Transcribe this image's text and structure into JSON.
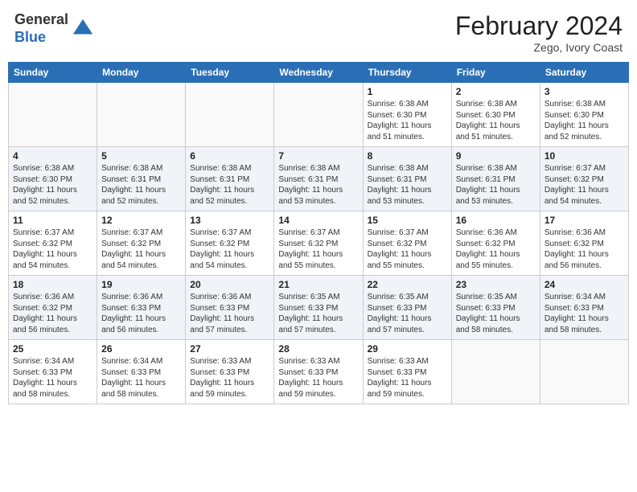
{
  "logo": {
    "general": "General",
    "blue": "Blue"
  },
  "header": {
    "month": "February 2024",
    "location": "Zego, Ivory Coast"
  },
  "weekdays": [
    "Sunday",
    "Monday",
    "Tuesday",
    "Wednesday",
    "Thursday",
    "Friday",
    "Saturday"
  ],
  "weeks": [
    [
      {
        "day": "",
        "info": ""
      },
      {
        "day": "",
        "info": ""
      },
      {
        "day": "",
        "info": ""
      },
      {
        "day": "",
        "info": ""
      },
      {
        "day": "1",
        "info": "Sunrise: 6:38 AM\nSunset: 6:30 PM\nDaylight: 11 hours\nand 51 minutes."
      },
      {
        "day": "2",
        "info": "Sunrise: 6:38 AM\nSunset: 6:30 PM\nDaylight: 11 hours\nand 51 minutes."
      },
      {
        "day": "3",
        "info": "Sunrise: 6:38 AM\nSunset: 6:30 PM\nDaylight: 11 hours\nand 52 minutes."
      }
    ],
    [
      {
        "day": "4",
        "info": "Sunrise: 6:38 AM\nSunset: 6:30 PM\nDaylight: 11 hours\nand 52 minutes."
      },
      {
        "day": "5",
        "info": "Sunrise: 6:38 AM\nSunset: 6:31 PM\nDaylight: 11 hours\nand 52 minutes."
      },
      {
        "day": "6",
        "info": "Sunrise: 6:38 AM\nSunset: 6:31 PM\nDaylight: 11 hours\nand 52 minutes."
      },
      {
        "day": "7",
        "info": "Sunrise: 6:38 AM\nSunset: 6:31 PM\nDaylight: 11 hours\nand 53 minutes."
      },
      {
        "day": "8",
        "info": "Sunrise: 6:38 AM\nSunset: 6:31 PM\nDaylight: 11 hours\nand 53 minutes."
      },
      {
        "day": "9",
        "info": "Sunrise: 6:38 AM\nSunset: 6:31 PM\nDaylight: 11 hours\nand 53 minutes."
      },
      {
        "day": "10",
        "info": "Sunrise: 6:37 AM\nSunset: 6:32 PM\nDaylight: 11 hours\nand 54 minutes."
      }
    ],
    [
      {
        "day": "11",
        "info": "Sunrise: 6:37 AM\nSunset: 6:32 PM\nDaylight: 11 hours\nand 54 minutes."
      },
      {
        "day": "12",
        "info": "Sunrise: 6:37 AM\nSunset: 6:32 PM\nDaylight: 11 hours\nand 54 minutes."
      },
      {
        "day": "13",
        "info": "Sunrise: 6:37 AM\nSunset: 6:32 PM\nDaylight: 11 hours\nand 54 minutes."
      },
      {
        "day": "14",
        "info": "Sunrise: 6:37 AM\nSunset: 6:32 PM\nDaylight: 11 hours\nand 55 minutes."
      },
      {
        "day": "15",
        "info": "Sunrise: 6:37 AM\nSunset: 6:32 PM\nDaylight: 11 hours\nand 55 minutes."
      },
      {
        "day": "16",
        "info": "Sunrise: 6:36 AM\nSunset: 6:32 PM\nDaylight: 11 hours\nand 55 minutes."
      },
      {
        "day": "17",
        "info": "Sunrise: 6:36 AM\nSunset: 6:32 PM\nDaylight: 11 hours\nand 56 minutes."
      }
    ],
    [
      {
        "day": "18",
        "info": "Sunrise: 6:36 AM\nSunset: 6:32 PM\nDaylight: 11 hours\nand 56 minutes."
      },
      {
        "day": "19",
        "info": "Sunrise: 6:36 AM\nSunset: 6:33 PM\nDaylight: 11 hours\nand 56 minutes."
      },
      {
        "day": "20",
        "info": "Sunrise: 6:36 AM\nSunset: 6:33 PM\nDaylight: 11 hours\nand 57 minutes."
      },
      {
        "day": "21",
        "info": "Sunrise: 6:35 AM\nSunset: 6:33 PM\nDaylight: 11 hours\nand 57 minutes."
      },
      {
        "day": "22",
        "info": "Sunrise: 6:35 AM\nSunset: 6:33 PM\nDaylight: 11 hours\nand 57 minutes."
      },
      {
        "day": "23",
        "info": "Sunrise: 6:35 AM\nSunset: 6:33 PM\nDaylight: 11 hours\nand 58 minutes."
      },
      {
        "day": "24",
        "info": "Sunrise: 6:34 AM\nSunset: 6:33 PM\nDaylight: 11 hours\nand 58 minutes."
      }
    ],
    [
      {
        "day": "25",
        "info": "Sunrise: 6:34 AM\nSunset: 6:33 PM\nDaylight: 11 hours\nand 58 minutes."
      },
      {
        "day": "26",
        "info": "Sunrise: 6:34 AM\nSunset: 6:33 PM\nDaylight: 11 hours\nand 58 minutes."
      },
      {
        "day": "27",
        "info": "Sunrise: 6:33 AM\nSunset: 6:33 PM\nDaylight: 11 hours\nand 59 minutes."
      },
      {
        "day": "28",
        "info": "Sunrise: 6:33 AM\nSunset: 6:33 PM\nDaylight: 11 hours\nand 59 minutes."
      },
      {
        "day": "29",
        "info": "Sunrise: 6:33 AM\nSunset: 6:33 PM\nDaylight: 11 hours\nand 59 minutes."
      },
      {
        "day": "",
        "info": ""
      },
      {
        "day": "",
        "info": ""
      }
    ]
  ]
}
